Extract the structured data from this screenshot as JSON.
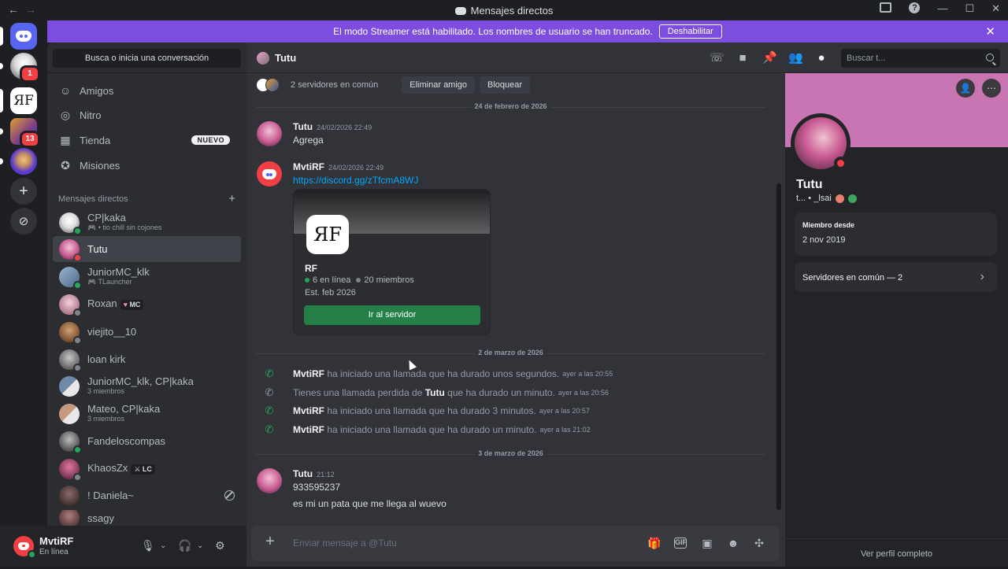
{
  "window": {
    "title": "Mensajes directos"
  },
  "guilds": [
    {
      "name": "home",
      "badge": ""
    },
    {
      "name": "server-white-avatar",
      "badge": "1"
    },
    {
      "name": "server-rf",
      "badge": ""
    },
    {
      "name": "server-game",
      "badge": "13"
    },
    {
      "name": "server-purple",
      "badge": ""
    }
  ],
  "banner": {
    "text": "El modo Streamer está habilitado. Los nombres de usuario se han truncado.",
    "button": "Deshabilitar"
  },
  "dm_sidebar": {
    "search": "Busca o inicia una conversación",
    "nav": [
      {
        "label": "Amigos",
        "icon": "friends-icon"
      },
      {
        "label": "Nitro",
        "icon": "nitro-icon"
      },
      {
        "label": "Tienda",
        "icon": "shop-icon",
        "badge": "NUEVO"
      },
      {
        "label": "Misiones",
        "icon": "quests-icon"
      }
    ],
    "dm_header": "Mensajes directos",
    "dms": [
      {
        "name": "CP|kaka",
        "sub": "• tio chill sin cojones",
        "status": "on",
        "color": "#e8e8e8"
      },
      {
        "name": "Tutu",
        "sub": "",
        "status": "dnd",
        "color": "#d48fbd"
      },
      {
        "name": "JuniorMC_klk",
        "sub": "TLauncher",
        "status": "on",
        "color": "#6e8aa6"
      },
      {
        "name": "Roxan",
        "sub": "",
        "tag": "MC",
        "status": "off",
        "color": "#c49aa6"
      },
      {
        "name": "viejito__10",
        "sub": "",
        "status": "off",
        "color": "#8a6b4c"
      },
      {
        "name": "loan kirk",
        "sub": "",
        "status": "off",
        "color": "#7a7a7a"
      },
      {
        "name": "JuniorMC_klk, CP|kaka",
        "sub": "3 miembros",
        "status": "",
        "color": "#5b7fa8"
      },
      {
        "name": "Mateo, CP|kaka",
        "sub": "3 miembros",
        "status": "",
        "color": "#c49a80"
      },
      {
        "name": "Fandeloscompas",
        "sub": "",
        "status": "on",
        "color": "#6a6a6a"
      },
      {
        "name": "KhaosZx",
        "sub": "",
        "tag": "LC",
        "status": "off",
        "color": "#a04a6a"
      },
      {
        "name": "! Daniela~",
        "sub": "",
        "status": "",
        "color": "#5a4a4a"
      },
      {
        "name": "ssagy",
        "sub": "",
        "status": "",
        "color": "#6a5050"
      }
    ]
  },
  "user_panel": {
    "name": "MvtiRF",
    "status": "En línea"
  },
  "chat_header": {
    "name": "Tutu",
    "search_placeholder": "Buscar t..."
  },
  "chat": {
    "mutual_text": "2 servidores en común",
    "btn_remove": "Eliminar amigo",
    "btn_block": "Bloquear",
    "date1": "24 de febrero de 2026",
    "date2": "2 de marzo de 2026",
    "date3": "3 de marzo de 2026",
    "msg1": {
      "author": "Tutu",
      "time": "24/02/2026 22:49",
      "text": "Agrega"
    },
    "msg2": {
      "author": "MvtiRF",
      "time": "24/02/2026 22:49",
      "link": "https://discord.gg/zTfcmA8WJ"
    },
    "invite": {
      "icon_text": "ЯF",
      "name": "RF",
      "online": "6 en línea",
      "members": "20 miembros",
      "est": "Est. feb 2026",
      "button": "Ir al servidor"
    },
    "calls": [
      {
        "who": "MvtiRF",
        "text": "ha iniciado una llamada que ha durado unos segundos.",
        "time": "ayer a las 20:55",
        "missed": false
      },
      {
        "who": "",
        "text": "Tienes una llamada perdida de",
        "who2": "Tutu",
        "text2": "que ha durado un minuto.",
        "time": "ayer a las 20:56",
        "missed": true
      },
      {
        "who": "MvtiRF",
        "text": "ha iniciado una llamada que ha durado 3 minutos.",
        "time": "ayer a las 20:57",
        "missed": false
      },
      {
        "who": "MvtiRF",
        "text": "ha iniciado una llamada que ha durado un minuto.",
        "time": "ayer a las 21:02",
        "missed": false
      }
    ],
    "msg3": {
      "author": "Tutu",
      "time": "21:12",
      "line1": "933595237",
      "line2": "es mi un pata que me llega al wuevo"
    },
    "input_placeholder": "Enviar mensaje a @Tutu"
  },
  "profile": {
    "name": "Tutu",
    "username": "t... • _lsai",
    "member_since_label": "Miembro desde",
    "member_since": "2 nov 2019",
    "mutual_servers": "Servidores en común — 2",
    "full_profile": "Ver perfil completo",
    "banner_color": "#c975b3"
  },
  "colors": {
    "accent": "#5865f2",
    "banner": "#7c4dde",
    "online": "#23a55a",
    "dnd": "#f23f43",
    "link": "#00a8fc"
  }
}
